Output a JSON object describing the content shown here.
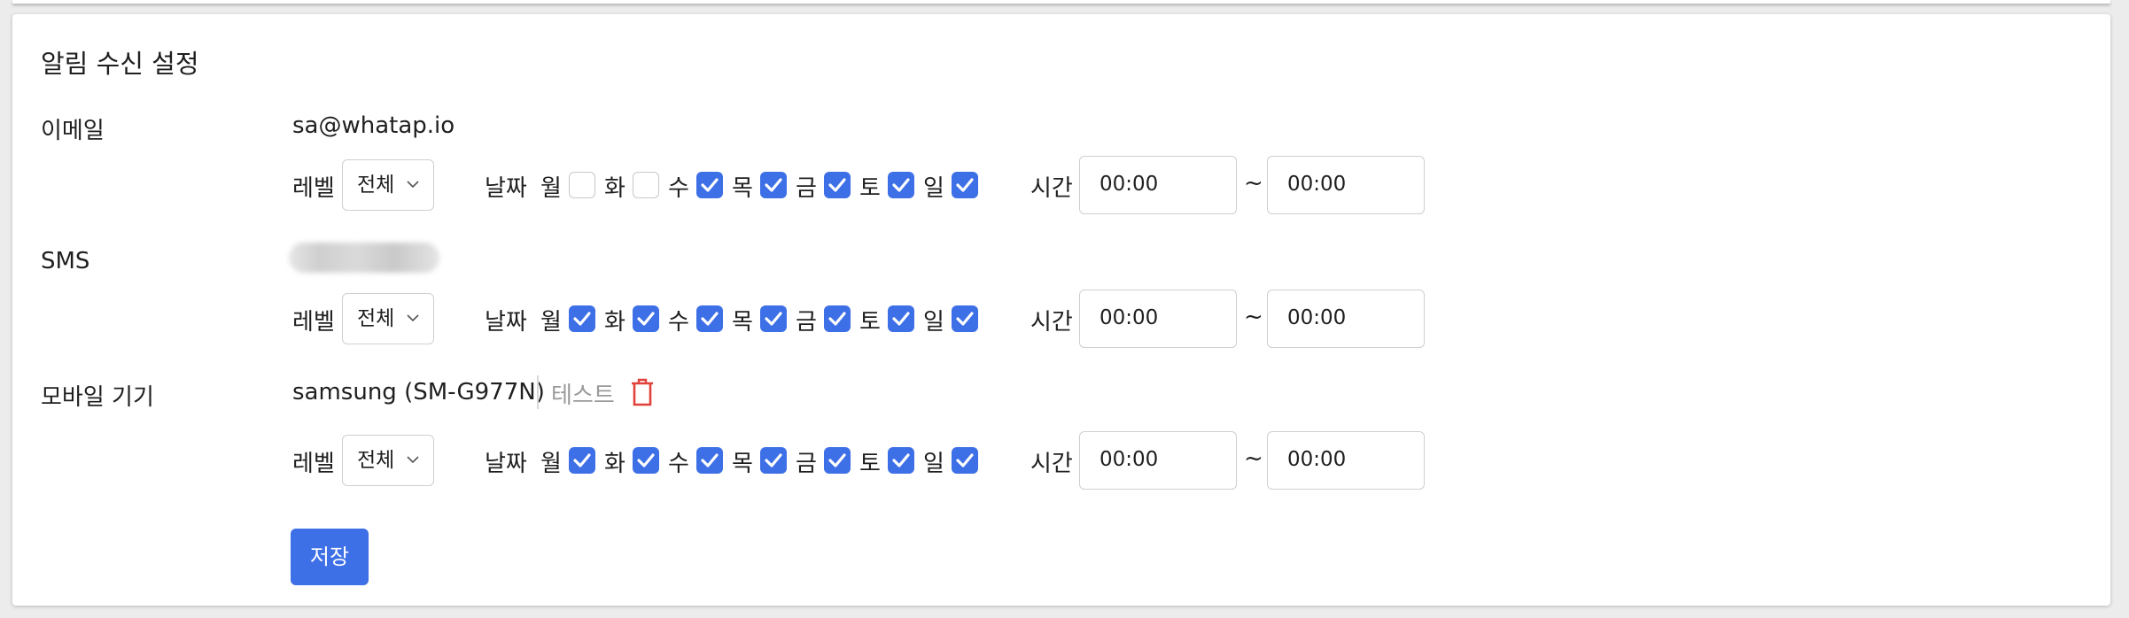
{
  "title": "알림 수신 설정",
  "labels": {
    "level": "레벨",
    "date": "날짜",
    "time": "시간",
    "tilde": "~"
  },
  "days": [
    "월",
    "화",
    "수",
    "목",
    "금",
    "토",
    "일"
  ],
  "email": {
    "label": "이메일",
    "value": "sa@whatap.io",
    "level": "전체",
    "days_checked": [
      false,
      false,
      true,
      true,
      true,
      true,
      true
    ],
    "time_from": "00:00",
    "time_to": "00:00"
  },
  "sms": {
    "label": "SMS",
    "level": "전체",
    "days_checked": [
      true,
      true,
      true,
      true,
      true,
      true,
      true
    ],
    "time_from": "00:00",
    "time_to": "00:00"
  },
  "mobile": {
    "label": "모바일 기기",
    "device": "samsung (SM-G977N)",
    "test_label": "테스트",
    "level": "전체",
    "days_checked": [
      true,
      true,
      true,
      true,
      true,
      true,
      true
    ],
    "time_from": "00:00",
    "time_to": "00:00"
  },
  "save_label": "저장",
  "colors": {
    "accent": "#3d6fe6",
    "danger": "#e0413a"
  }
}
